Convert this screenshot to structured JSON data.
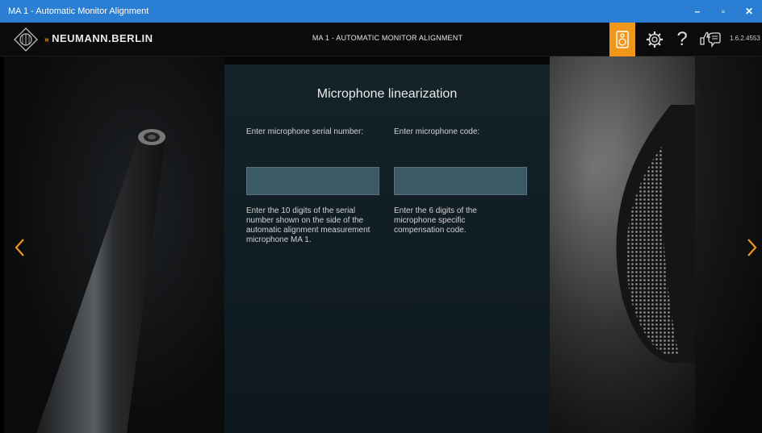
{
  "window": {
    "title": "MA 1 - Automatic Monitor Alignment",
    "controls": {
      "minimize": "–",
      "restore": "▫",
      "close": "✕"
    }
  },
  "header": {
    "brand": "NEUMANN.BERLIN",
    "brand_arrow": "»",
    "title": "MA 1 - AUTOMATIC MONITOR ALIGNMENT",
    "version": "1.6.2.4553",
    "help": "?",
    "accent_color": "#f0961a"
  },
  "main": {
    "heading": "Microphone linearization",
    "serial": {
      "label": "Enter microphone serial number:",
      "value": "",
      "help": "Enter the 10 digits of the serial number shown on the side of the automatic alignment measurement microphone MA 1."
    },
    "code": {
      "label": "Enter microphone code:",
      "value": "",
      "help": "Enter the 6 digits of the microphone specific compensation code."
    }
  },
  "nav": {
    "prev": "previous-page",
    "next": "next-page"
  }
}
